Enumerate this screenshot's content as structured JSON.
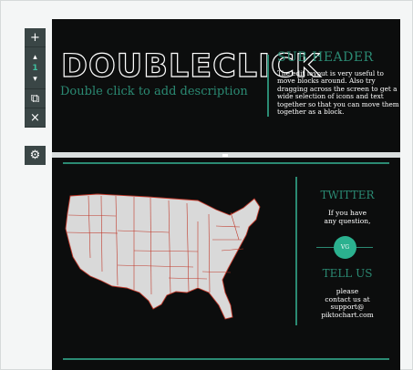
{
  "toolbar": {
    "add": "+",
    "move_up": "▴",
    "position": "1",
    "move_down": "▾",
    "duplicate": "⧉",
    "delete": "×",
    "settings": "⚙"
  },
  "header": {
    "title": "DOUBLECLICK",
    "description": "Double click to add description",
    "subheader": "SUB HEADER",
    "subtext": "The edit layout is very useful to move blocks around. Also try dragging across the screen to get a wide selection of icons and text together so that you can move them together as a block."
  },
  "contact": {
    "twitter_title": "TWITTER",
    "twitter_text_1": "If you have",
    "twitter_text_2": "any question,",
    "badge": "VG",
    "tellus_title": "TELL US",
    "tellus_text_1": "please",
    "tellus_text_2": "contact us at",
    "tellus_text_3": "support@",
    "tellus_text_4": "piktochart.com"
  },
  "colors": {
    "canvas": "#0c0d0d",
    "accent": "#2b8a73",
    "badge": "#2bb18f",
    "map_fill": "#d9d9d9",
    "map_border": "#c0392b",
    "toolbar": "#3a4646"
  }
}
